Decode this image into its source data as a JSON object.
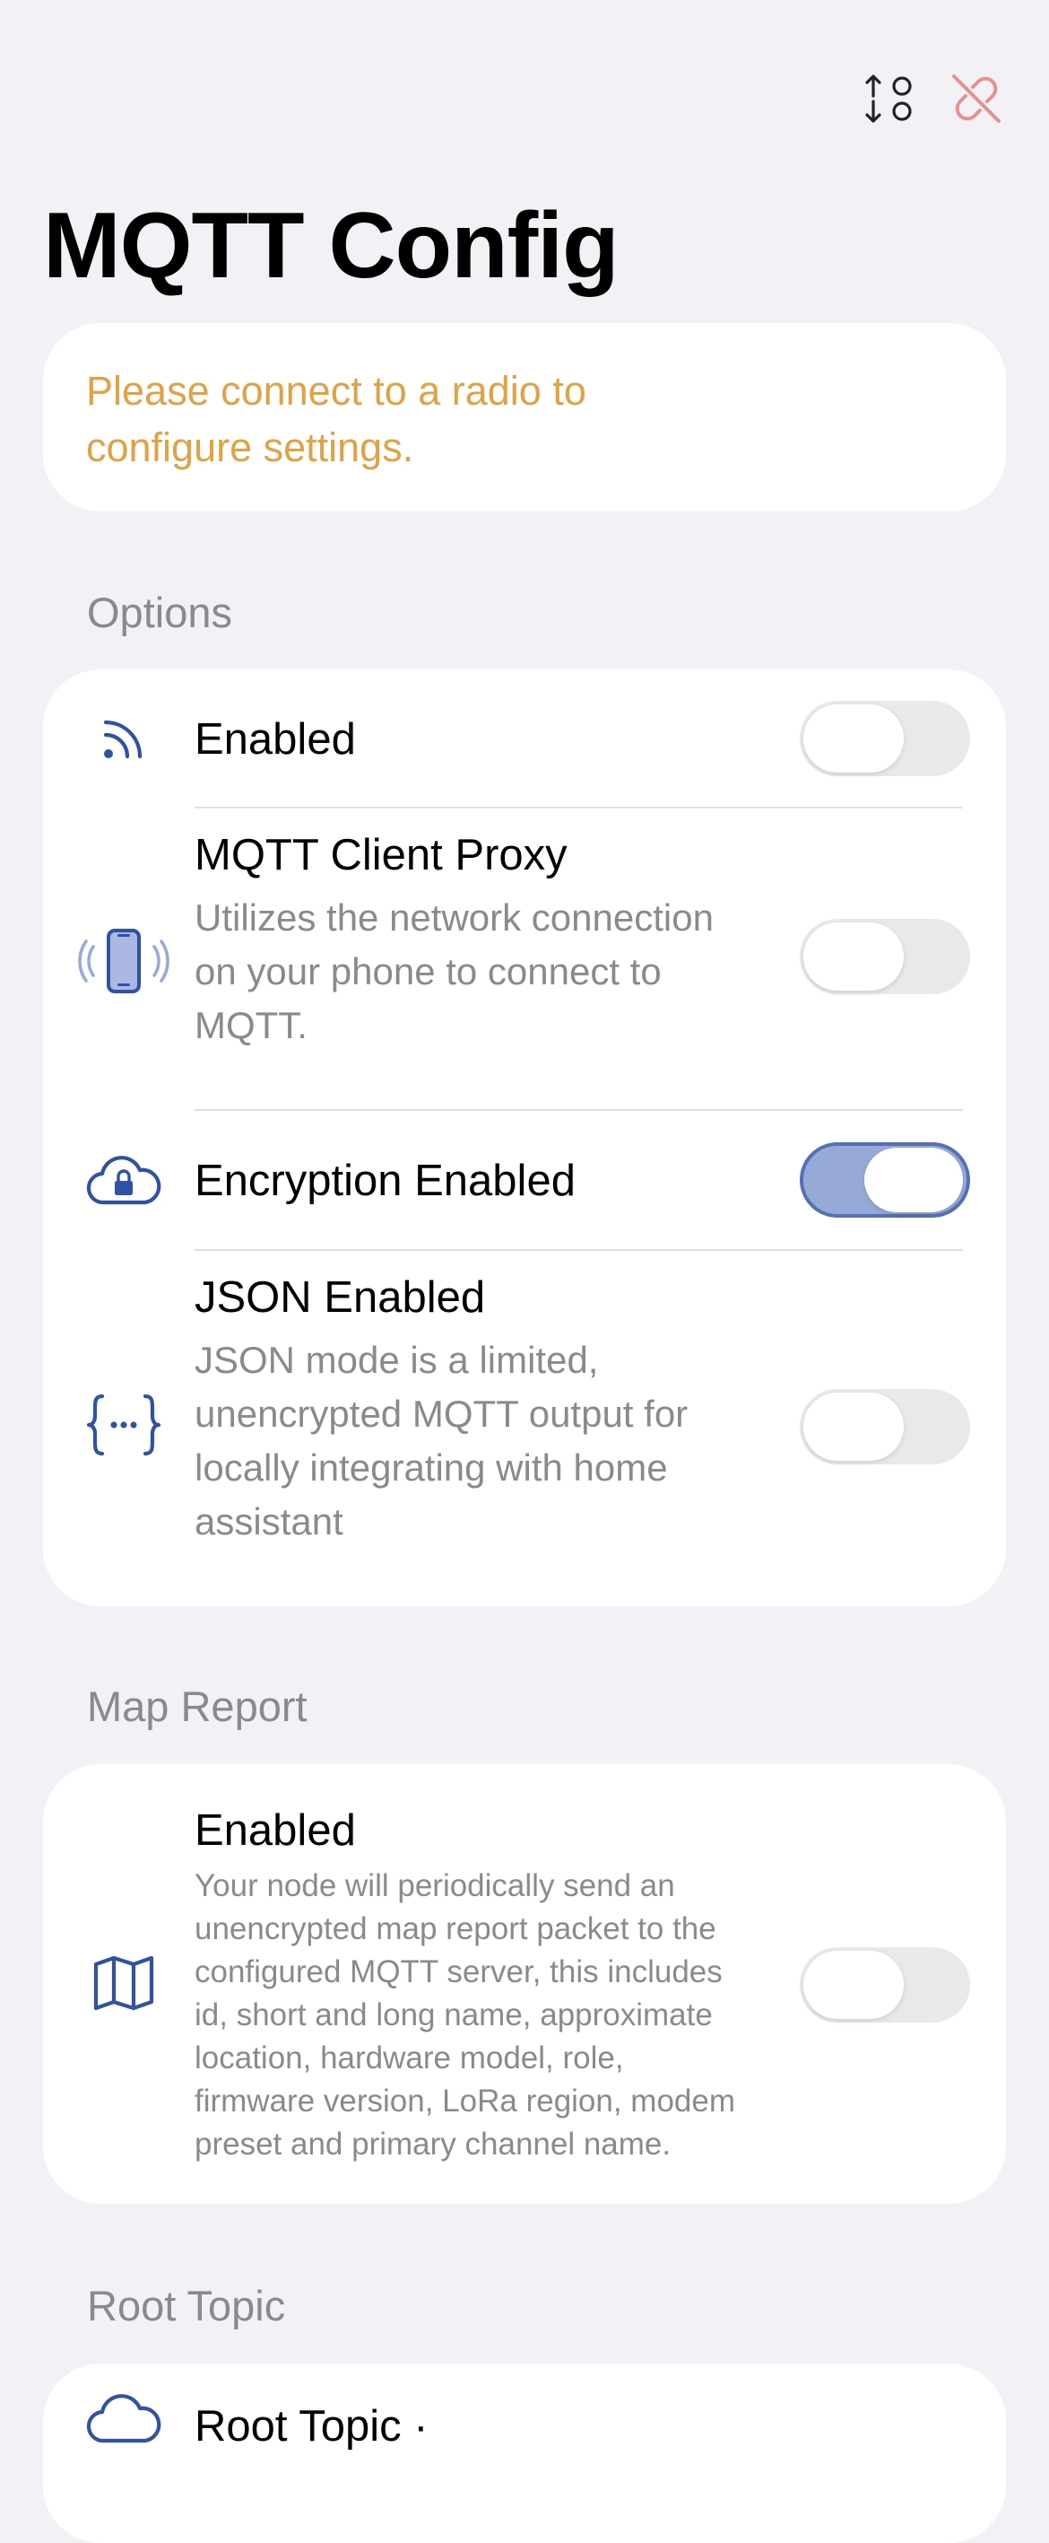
{
  "header": {
    "title": "MQTT Config",
    "icons": [
      "sort-arrows-icon",
      "link-slash-icon"
    ]
  },
  "warning": {
    "line1": "Please connect to a radio to",
    "line2": "configure settings."
  },
  "options": {
    "label": "Options",
    "items": [
      {
        "icon": "wifi-signal-icon",
        "title": "Enabled",
        "enabled": false
      },
      {
        "icon": "phone-wireless-icon",
        "title": "MQTT Client Proxy",
        "desc1": "Utilizes the network connection",
        "desc2": "on your phone to connect to",
        "desc3": "MQTT.",
        "enabled": false
      },
      {
        "icon": "cloud-lock-icon",
        "title": "Encryption Enabled",
        "enabled": true
      },
      {
        "icon": "curly-braces-icon",
        "title": "JSON Enabled",
        "desc1": "JSON mode is a limited,",
        "desc2": "unencrypted MQTT output for",
        "desc3": "locally integrating with home",
        "desc4": "assistant",
        "enabled": false
      }
    ]
  },
  "map_report": {
    "label": "Map Report",
    "item": {
      "icon": "map-icon",
      "title": "Enabled",
      "lines": [
        "Your node will periodically send an",
        "unencrypted map report packet to the",
        "configured MQTT server, this includes",
        "id, short and long name, approximate",
        "location, hardware model, role,",
        "firmware version, LoRa region, modem",
        "preset and primary channel name."
      ],
      "enabled": false
    }
  },
  "root_topic": {
    "label": "Root Topic",
    "partial_title": "Root Topic ·"
  },
  "colors": {
    "accent": "#2f52a4",
    "warning": "#dfa245",
    "toggle_on": "#97a9d6",
    "link_off": "#e79090"
  }
}
